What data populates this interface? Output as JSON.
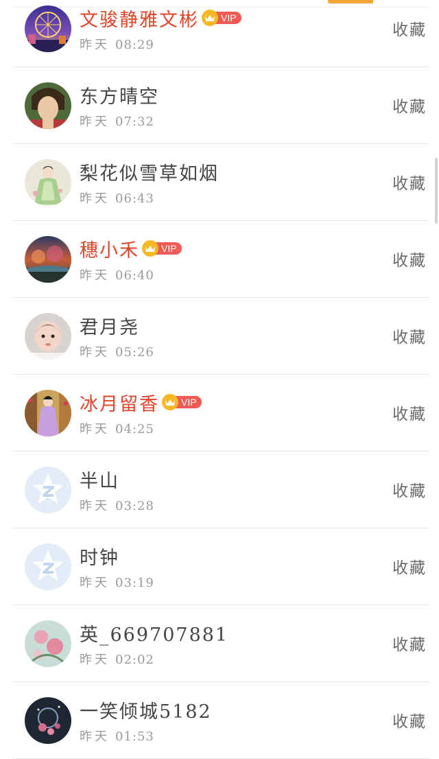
{
  "header": {
    "active_tab_color": "#f4a63a"
  },
  "rows": [
    {
      "name": "文骏静雅文彬",
      "vip": true,
      "vip_label": "VIP",
      "day": "昨天",
      "time": "08:29",
      "action": "收藏",
      "avatar": "ferris-wheel-avatar"
    },
    {
      "name": "东方晴空",
      "vip": false,
      "vip_label": "",
      "day": "昨天",
      "time": "07:32",
      "action": "收藏",
      "avatar": "anime-man-avatar"
    },
    {
      "name": "梨花似雪草如烟",
      "vip": false,
      "vip_label": "",
      "day": "昨天",
      "time": "06:43",
      "action": "收藏",
      "avatar": "painted-lady-avatar"
    },
    {
      "name": "穗小禾",
      "vip": true,
      "vip_label": "VIP",
      "day": "昨天",
      "time": "06:40",
      "action": "收藏",
      "avatar": "sunset-landscape-avatar"
    },
    {
      "name": "君月尧",
      "vip": false,
      "vip_label": "",
      "day": "昨天",
      "time": "05:26",
      "action": "收藏",
      "avatar": "baby-photo-avatar"
    },
    {
      "name": "冰月留香",
      "vip": true,
      "vip_label": "VIP",
      "day": "昨天",
      "time": "04:25",
      "action": "收藏",
      "avatar": "costume-lady-avatar"
    },
    {
      "name": "半山",
      "vip": false,
      "vip_label": "",
      "day": "昨天",
      "time": "03:28",
      "action": "收藏",
      "avatar": "default-star-avatar"
    },
    {
      "name": "时钟",
      "vip": false,
      "vip_label": "",
      "day": "昨天",
      "time": "03:19",
      "action": "收藏",
      "avatar": "default-star-avatar"
    },
    {
      "name": "英_669707881",
      "vip": false,
      "vip_label": "",
      "day": "昨天",
      "time": "02:02",
      "action": "收藏",
      "avatar": "flower-painting-avatar"
    },
    {
      "name": "一笑倾城5182",
      "vip": false,
      "vip_label": "",
      "day": "昨天",
      "time": "01:53",
      "action": "收藏",
      "avatar": "night-blossom-avatar"
    }
  ],
  "colors": {
    "vip_name": "#e0452b",
    "vip_badge": "#ef5a54",
    "crown": "#f6b824",
    "normal_name": "#454545",
    "time_text": "#9a9a9a"
  }
}
